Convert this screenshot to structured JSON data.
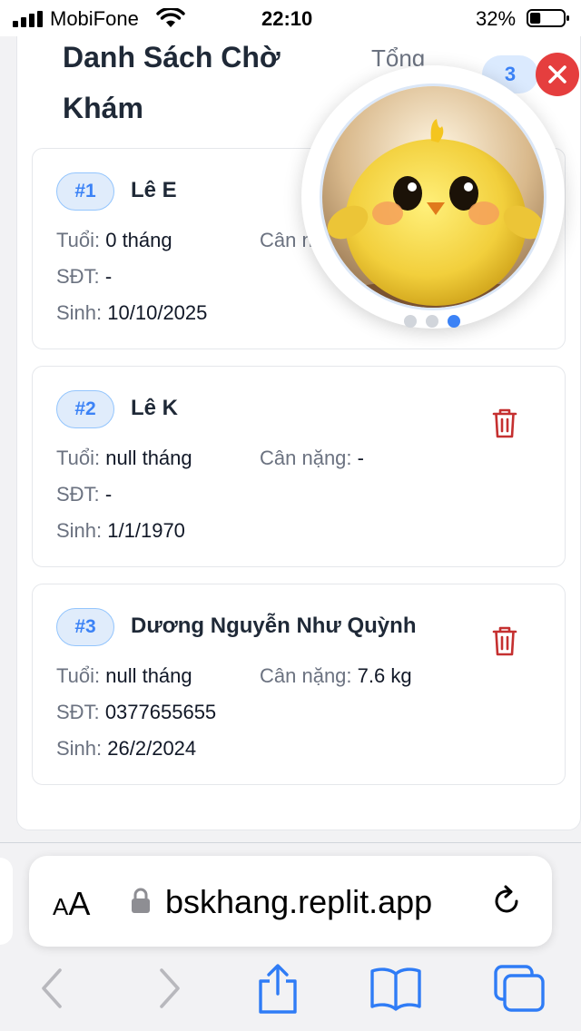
{
  "status_bar": {
    "carrier": "MobiFone",
    "time": "22:10",
    "battery_percent": "32%",
    "battery_level": 0.32,
    "icons": [
      "signal-icon",
      "wifi-icon",
      "battery-icon"
    ]
  },
  "header": {
    "title": "Danh Sách Chờ Khám",
    "total_label": "Tổng",
    "total_count": "3"
  },
  "labels": {
    "age": "Tuổi:",
    "weight": "Cân nặng:",
    "phone": "SĐT:",
    "birth": "Sinh:"
  },
  "patients": [
    {
      "index": "#1",
      "name": "Lê E",
      "age": "0 tháng",
      "weight": "",
      "phone": "-",
      "birth": "10/10/2025"
    },
    {
      "index": "#2",
      "name": "Lê K",
      "age": "null tháng",
      "weight": "-",
      "phone": "-",
      "birth": "1/1/1970"
    },
    {
      "index": "#3",
      "name": "Dương Nguyễn Như Quỳnh",
      "age": "null tháng",
      "weight": "7.6 kg",
      "phone": "0377655655",
      "birth": "26/2/2024"
    }
  ],
  "avatar_widget": {
    "image": "yellow-chick-mascot",
    "page_count": 3,
    "active_page": 3
  },
  "browser": {
    "text_size_label_small": "A",
    "text_size_label_big": "A",
    "url": "bskhang.replit.app",
    "toolbar_icons": [
      "back-icon",
      "forward-icon",
      "share-icon",
      "bookmarks-icon",
      "tabs-icon"
    ]
  },
  "colors": {
    "accent": "#3b82f6",
    "delete": "#c53030",
    "close": "#e53e3e"
  }
}
